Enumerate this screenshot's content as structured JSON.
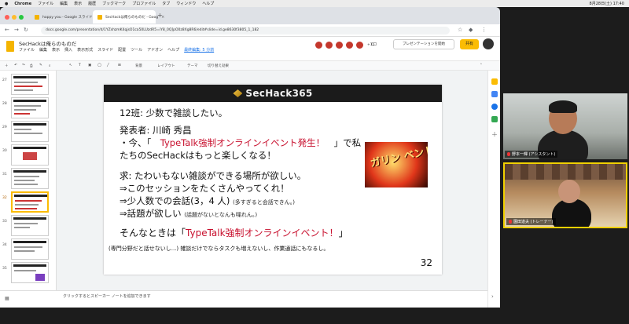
{
  "macos": {
    "app": "Chrome",
    "menus": [
      "ファイル",
      "編集",
      "表示",
      "履歴",
      "ブックマーク",
      "プロファイル",
      "タブ",
      "ウィンドウ",
      "ヘルプ"
    ],
    "datetime": "8月28日(土)  17:40"
  },
  "browser": {
    "tabs": [
      {
        "label": "happy you - Google スライド",
        "active": false
      },
      {
        "label": "SecHackは俺らのものだ - Goog",
        "active": true
      }
    ],
    "url": "docs.google.com/presentation/d/1YZshzmK4qjsO1ca50LUzdR5=iY8_0Q]pO0z8Xg8R6/edit#slide=id.ge8630f3805_1_182"
  },
  "doc": {
    "title": "SecHackは俺らのものだ",
    "menu": [
      "ファイル",
      "編集",
      "表示",
      "挿入",
      "表示形式",
      "スライド",
      "配置",
      "ツール",
      "アドオン",
      "ヘルプ"
    ],
    "last_edit": "最終編集: 5 分前",
    "collaborators_extra": "+15",
    "present_label": "プレゼンテーションを開始",
    "share_label": "共有",
    "toolbar_items": [
      "背景",
      "レイアウト",
      "テーマ",
      "切り替え効果"
    ],
    "notes_placeholder": "クリックするとスピーカー ノートを追加できます"
  },
  "filmstrip": {
    "slide_numbers": [
      "27",
      "28",
      "29",
      "30",
      "31",
      "32",
      "33",
      "34",
      "35"
    ],
    "selected": "32"
  },
  "slide": {
    "brand": "SecHack365",
    "line1": "12班: 少数で雑談したい。",
    "line2": "発表者: 川崎 秀昌",
    "line3_a": "・今、「　",
    "line3_red": "TypeTalk強制オンラインイベント発生！",
    "line3_b": "　」で私",
    "line4": "たちのSecHackはもっと楽しくなる！",
    "line5": "求: たわいもない雑談ができる場所が欲しい。",
    "line6": "⇒このセッションをたくさんやってくれ！",
    "line7": "⇒少人数での会話(3，4 人)",
    "line7_note": "(多すぎると会話できん。)",
    "line8": "⇒話題が欲しい",
    "line8_note": "(話題がないとなんも喋れん。)",
    "line9_a": "そんなときは「",
    "line9_red": "TypeTalk強制オンラインイベント！",
    "line9_b": "」",
    "line10": "(専門分野だと話せないし...) 雑談だけでならタスクも増えないし、作業通話にもなるし。",
    "promo_text": "ガリン ベント",
    "page_number": "32"
  },
  "video": {
    "participants": [
      {
        "name": "野本一輝 (アシスタント)",
        "muted": true
      },
      {
        "name": "園田道夫 (トレーナー)",
        "muted": false
      }
    ]
  },
  "colors": {
    "accent_yellow": "#fbbc04",
    "slide_red": "#c8102e",
    "header_black": "#1b1b1b"
  }
}
